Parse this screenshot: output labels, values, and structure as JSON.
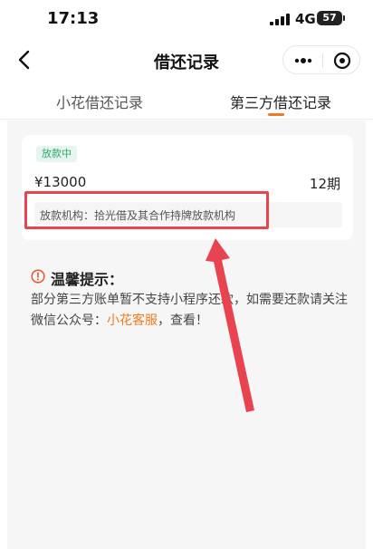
{
  "status_bar": {
    "time": "17:13",
    "network": "4G",
    "battery": "57"
  },
  "nav": {
    "title": "借还记录"
  },
  "tabs": [
    {
      "label": "小花借还记录",
      "active": false
    },
    {
      "label": "第三方借还记录",
      "active": true
    }
  ],
  "record": {
    "status": "放款中",
    "amount": "¥13000",
    "periods": "12期",
    "lender": "放款机构：拾光借及其合作持牌放款机构"
  },
  "tips": {
    "title": "温馨提示：",
    "text_before": "部分第三方账单暂不支持小程序还款，如需要还款请关注微信公众号：",
    "link": "小花客服",
    "text_after": "，查看！"
  },
  "colors": {
    "accent": "#f07a1f",
    "status_green": "#2fa86b",
    "annotation_red": "#e8444f"
  },
  "icons": [
    "back-arrow-icon",
    "more-dots-icon",
    "target-circle-icon",
    "warning-icon",
    "signal-icon",
    "battery-icon"
  ]
}
